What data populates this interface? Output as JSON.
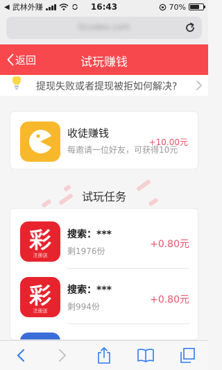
{
  "status_bar": {
    "carrier": "武林外赚",
    "time": "16:43",
    "battery": "70%",
    "battery_level": 0.7
  },
  "address_bar": {
    "url": "ttcodex.com"
  },
  "header": {
    "back_label": "返回",
    "title": "试玩赚钱"
  },
  "help": {
    "text": "提现失败或者提现被拒如何解决?"
  },
  "invite": {
    "title": "收徒赚钱",
    "description": "每邀请一位好友，可获得10元",
    "reward": "+10.00元"
  },
  "section": {
    "title": "试玩任务"
  },
  "tasks": [
    {
      "title": "搜索：***",
      "remaining": "剩1976份",
      "reward": "+0.80元",
      "icon_char": "彩",
      "icon_sub": "注册送"
    },
    {
      "title": "搜索：***",
      "remaining": "剩994份",
      "reward": "+0.80元",
      "icon_char": "彩",
      "icon_sub": "注册送"
    }
  ],
  "colors": {
    "header_bg": "#f7484e",
    "reward": "#e8546a",
    "invite_icon": "#f8b82c",
    "task_icon": "#e7232d",
    "toolbar_icon": "#2f7cf6"
  }
}
